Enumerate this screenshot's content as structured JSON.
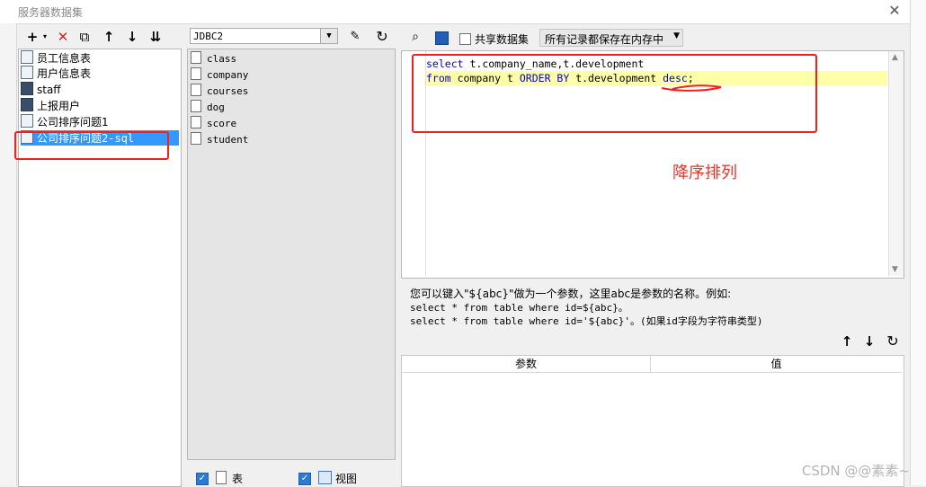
{
  "window": {
    "title": "服务器数据集",
    "close_symbol": "✕"
  },
  "left_toolbar": {
    "add": "+",
    "delete": "✕",
    "copy": "⧉",
    "up": "↑",
    "down": "↓",
    "move": "⇊"
  },
  "datasets": [
    {
      "label": "员工信息表",
      "icon": "dataset-icon"
    },
    {
      "label": "用户信息表",
      "icon": "dataset-icon"
    },
    {
      "label": "staff",
      "icon": "db-table-icon"
    },
    {
      "label": "上报用户",
      "icon": "db-table-icon"
    },
    {
      "label": "公司排序问题1",
      "icon": "dataset-icon"
    },
    {
      "label": "公司排序问题2-sql",
      "icon": "dataset-icon",
      "selected": true
    }
  ],
  "connection": {
    "selected": "JDBC2"
  },
  "tables": [
    "class",
    "company",
    "courses",
    "dog",
    "score",
    "student"
  ],
  "mid_bottom": {
    "table_label": "表",
    "view_label": "视图"
  },
  "sql_toolbar": {
    "shared_label": "共享数据集",
    "cache_mode": "所有记录都保存在内存中"
  },
  "sql": {
    "line1": {
      "kw1": "select",
      "rest": " t.company_name,t.development"
    },
    "line2": {
      "kw1": "from",
      "t1": " company t ",
      "kw2": "ORDER BY",
      "t2": " t.development ",
      "kw3": "desc",
      "t3": ";"
    }
  },
  "annotation": {
    "text": "降序排列"
  },
  "hint": {
    "line1": "您可以键入\"${abc}\"做为一个参数，这里abc是参数的名称。例如:",
    "line2": "select * from table where id=${abc}。",
    "line3": "select * from table where id='${abc}'。(如果id字段为字符串类型)"
  },
  "params_table": {
    "col_param": "参数",
    "col_value": "值"
  },
  "param_buttons": {
    "up": "↑",
    "down": "↓",
    "refresh": "↻"
  },
  "watermark": "CSDN @@素素~",
  "colors": {
    "selection": "#3399ff",
    "keyword": "#0000cc",
    "annotation_red": "#ee2222",
    "current_line": "#ffffa8"
  }
}
